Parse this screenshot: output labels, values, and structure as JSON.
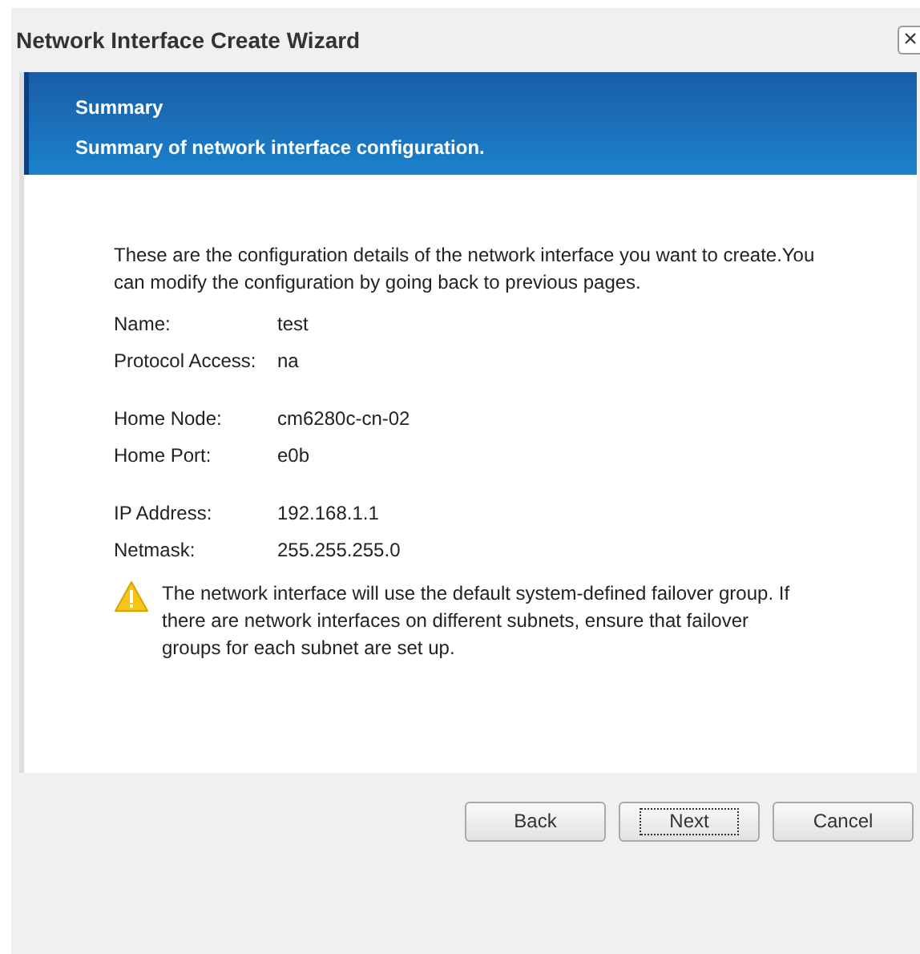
{
  "window": {
    "title": "Network Interface Create Wizard",
    "close": "×"
  },
  "banner": {
    "title": "Summary",
    "subtitle": "Summary of network interface configuration."
  },
  "intro": "These are the configuration details of the network interface you want to create.You can modify the configuration by going back to previous pages.",
  "detail_groups": [
    [
      {
        "label": "Name:",
        "value": "test"
      },
      {
        "label": "Protocol Access:",
        "value": "na"
      }
    ],
    [
      {
        "label": "Home Node:",
        "value": "cm6280c-cn-02"
      },
      {
        "label": "Home Port:",
        "value": "e0b"
      }
    ],
    [
      {
        "label": "IP Address:",
        "value": "192.168.1.1"
      },
      {
        "label": "Netmask:",
        "value": "255.255.255.0"
      }
    ]
  ],
  "warning": "The network interface will use the default system-defined failover group. If there are network interfaces on different subnets, ensure that failover groups for each subnet are set up.",
  "buttons": [
    {
      "label": "Back",
      "focused": false
    },
    {
      "label": "Next",
      "focused": true
    },
    {
      "label": "Cancel",
      "focused": false
    }
  ]
}
